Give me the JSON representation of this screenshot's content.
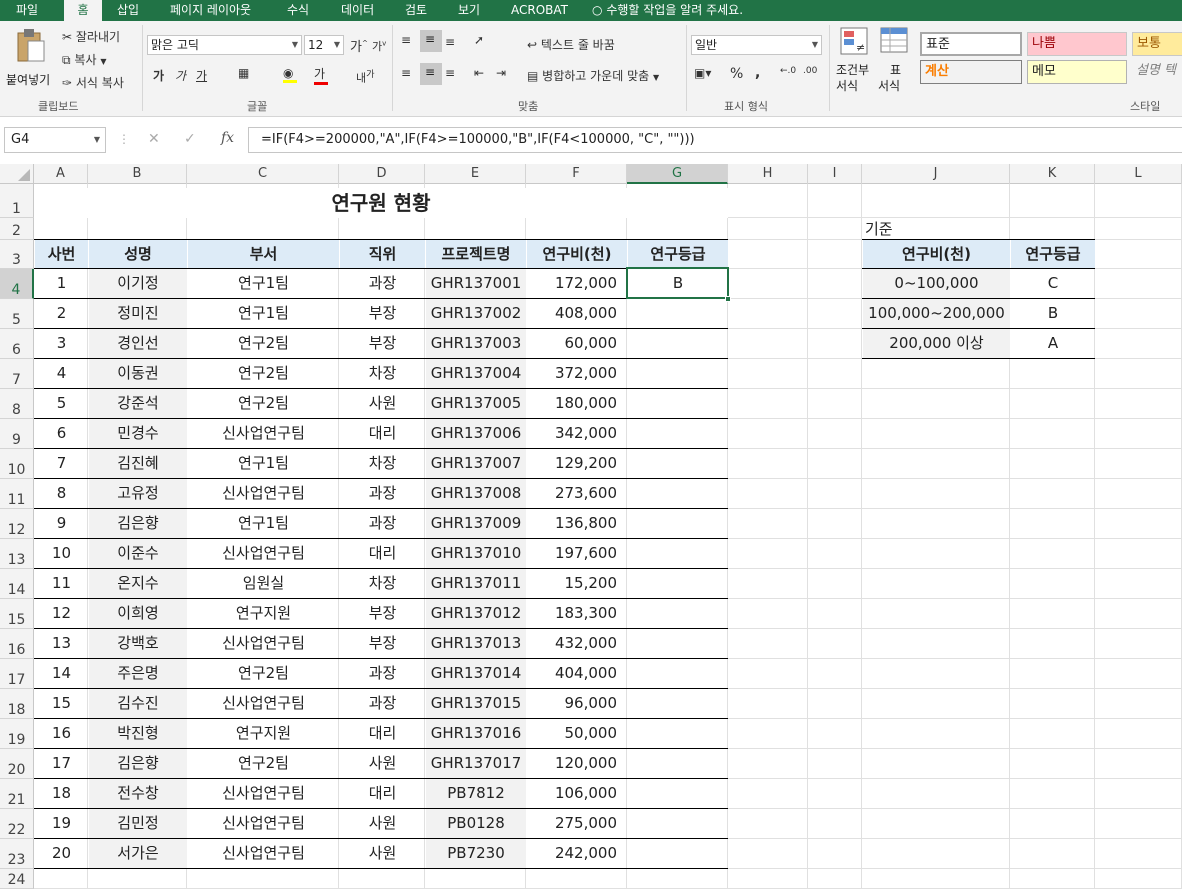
{
  "ribbon_tabs": [
    "파일",
    "홈",
    "삽입",
    "페이지 레이아웃",
    "수식",
    "데이터",
    "검토",
    "보기",
    "ACROBAT"
  ],
  "tell_me": "수행할 작업을 알려 주세요.",
  "clipboard": {
    "paste": "붙여넣기",
    "cut": "잘라내기",
    "copy": "복사",
    "format_painter": "서식 복사",
    "group": "클립보드"
  },
  "font": {
    "name": "맑은 고딕",
    "size": "12",
    "group": "글꼴"
  },
  "alignment": {
    "wrap": "텍스트 줄 바꿈",
    "merge": "병합하고 가운데 맞춤",
    "group": "맞춤"
  },
  "number": {
    "format": "일반",
    "group": "표시 형식"
  },
  "styles_group": {
    "conditional_line1": "조건부",
    "conditional_line2": "서식",
    "table_line1": "표",
    "table_line2": "서식",
    "group": "스타일"
  },
  "cell_styles": [
    "표준",
    "나쁨",
    "보통",
    "계산",
    "메모",
    "설명 텍"
  ],
  "name_box": "G4",
  "formula": "=IF(F4>=200000,\"A\",IF(F4>=100000,\"B\",IF(F4<100000, \"C\", \"\")))",
  "columns": [
    "A",
    "B",
    "C",
    "D",
    "E",
    "F",
    "G",
    "H",
    "I",
    "J",
    "K",
    "L"
  ],
  "rows": [
    "1",
    "2",
    "3",
    "4",
    "5",
    "6",
    "7",
    "8",
    "9",
    "10",
    "11",
    "12",
    "13",
    "14",
    "15",
    "16",
    "17",
    "18",
    "19",
    "20",
    "21",
    "22",
    "23",
    "24"
  ],
  "sheet": {
    "title": "연구원 현황",
    "headers": [
      "사번",
      "성명",
      "부서",
      "직위",
      "프로젝트명",
      "연구비(천)",
      "연구등급"
    ],
    "records": [
      [
        "1",
        "이기정",
        "연구1팀",
        "과장",
        "GHR137001",
        "172,000",
        "B"
      ],
      [
        "2",
        "정미진",
        "연구1팀",
        "부장",
        "GHR137002",
        "408,000",
        ""
      ],
      [
        "3",
        "경인선",
        "연구2팀",
        "부장",
        "GHR137003",
        "60,000",
        ""
      ],
      [
        "4",
        "이동권",
        "연구2팀",
        "차장",
        "GHR137004",
        "372,000",
        ""
      ],
      [
        "5",
        "강준석",
        "연구2팀",
        "사원",
        "GHR137005",
        "180,000",
        ""
      ],
      [
        "6",
        "민경수",
        "신사업연구팀",
        "대리",
        "GHR137006",
        "342,000",
        ""
      ],
      [
        "7",
        "김진혜",
        "연구1팀",
        "차장",
        "GHR137007",
        "129,200",
        ""
      ],
      [
        "8",
        "고유정",
        "신사업연구팀",
        "과장",
        "GHR137008",
        "273,600",
        ""
      ],
      [
        "9",
        "김은향",
        "연구1팀",
        "과장",
        "GHR137009",
        "136,800",
        ""
      ],
      [
        "10",
        "이준수",
        "신사업연구팀",
        "대리",
        "GHR137010",
        "197,600",
        ""
      ],
      [
        "11",
        "온지수",
        "임원실",
        "차장",
        "GHR137011",
        "15,200",
        ""
      ],
      [
        "12",
        "이희영",
        "연구지원",
        "부장",
        "GHR137012",
        "183,300",
        ""
      ],
      [
        "13",
        "강백호",
        "신사업연구팀",
        "부장",
        "GHR137013",
        "432,000",
        ""
      ],
      [
        "14",
        "주은명",
        "연구2팀",
        "과장",
        "GHR137014",
        "404,000",
        ""
      ],
      [
        "15",
        "김수진",
        "신사업연구팀",
        "과장",
        "GHR137015",
        "96,000",
        ""
      ],
      [
        "16",
        "박진형",
        "연구지원",
        "대리",
        "GHR137016",
        "50,000",
        ""
      ],
      [
        "17",
        "김은향",
        "연구2팀",
        "사원",
        "GHR137017",
        "120,000",
        ""
      ],
      [
        "18",
        "전수창",
        "신사업연구팀",
        "대리",
        "PB7812",
        "106,000",
        ""
      ],
      [
        "19",
        "김민정",
        "신사업연구팀",
        "사원",
        "PB0128",
        "275,000",
        ""
      ],
      [
        "20",
        "서가은",
        "신사업연구팀",
        "사원",
        "PB7230",
        "242,000",
        ""
      ]
    ],
    "criteria_label": "기준",
    "criteria_headers": [
      "연구비(천)",
      "연구등급"
    ],
    "criteria": [
      [
        "0~100,000",
        "C"
      ],
      [
        "100,000~200,000",
        "B"
      ],
      [
        "200,000 이상",
        "A"
      ]
    ]
  },
  "colors": {
    "accent": "#217346",
    "header_fill": "#ddebf7",
    "shade_fill": "#f2f2f2",
    "bad_fill": "#ffc7ce",
    "neutral_fill": "#ffeb9c",
    "note_fill": "#ffffcc"
  }
}
